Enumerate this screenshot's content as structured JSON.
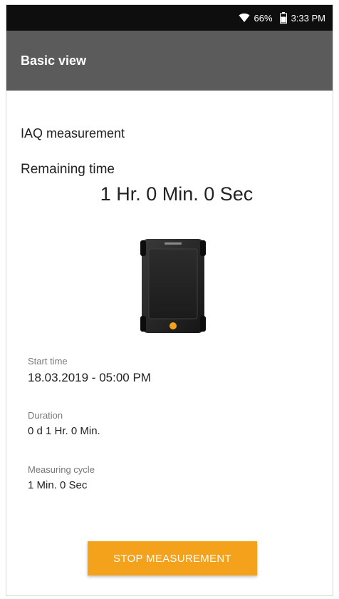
{
  "status_bar": {
    "battery_percent": "66%",
    "time": "3:33 PM",
    "icons": [
      "wifi-icon",
      "battery-icon"
    ]
  },
  "app_bar": {
    "title": "Basic view"
  },
  "measurement": {
    "section_title": "IAQ measurement",
    "remaining_label": "Remaining time",
    "remaining_value": "1 Hr. 0 Min. 0 Sec",
    "device_image": "data-logger-device"
  },
  "info": {
    "start_time_label": "Start time",
    "start_time_value": "18.03.2019 - 05:00 PM",
    "duration_label": "Duration",
    "duration_value": "0 d 1 Hr. 0 Min.",
    "cycle_label": "Measuring cycle",
    "cycle_value": "1 Min. 0 Sec"
  },
  "actions": {
    "stop_label": "STOP MEASUREMENT"
  },
  "colors": {
    "status_bar": "#0e0e0e",
    "app_bar": "#5b5b5b",
    "accent_button": "#f4a11c"
  }
}
